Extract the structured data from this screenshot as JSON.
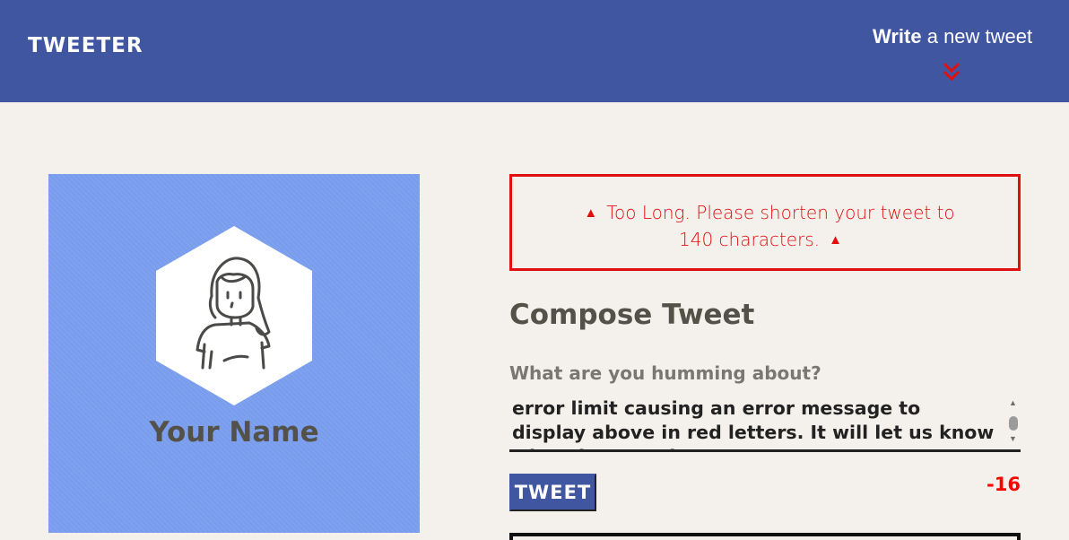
{
  "nav": {
    "brand": "TWEETER",
    "write_bold": "Write",
    "write_rest": " a new tweet",
    "icon": "double-chevron-down-icon"
  },
  "profile": {
    "name": "Your Name",
    "avatar_icon": "user-avatar-icon",
    "background_color": "#7b9ff0"
  },
  "error": {
    "message": "Too Long. Please shorten your tweet to 140 characters.",
    "icon": "warning-triangle-icon",
    "color": "#e01010"
  },
  "compose": {
    "title": "Compose Tweet",
    "label": "What are you humming about?",
    "text": "error limit causing an error message to display above in red letters. It will let us know what the error is.",
    "button_label": "TWEET",
    "counter": "-16",
    "counter_color": "#ff0000"
  },
  "colors": {
    "nav_bg": "#4056a1",
    "page_bg": "#f4f1ec",
    "text": "#545149"
  }
}
